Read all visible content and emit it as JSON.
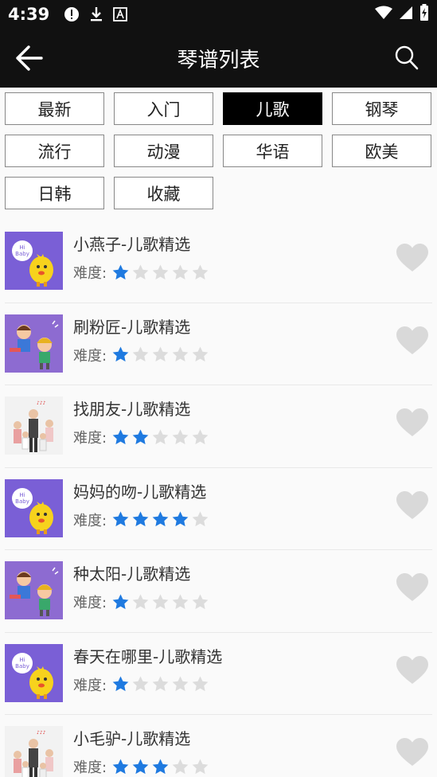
{
  "status": {
    "time": "4:39"
  },
  "header": {
    "title": "琴谱列表"
  },
  "filters": [
    {
      "label": "最新",
      "active": false
    },
    {
      "label": "入门",
      "active": false
    },
    {
      "label": "儿歌",
      "active": true
    },
    {
      "label": "钢琴",
      "active": false
    },
    {
      "label": "流行",
      "active": false
    },
    {
      "label": "动漫",
      "active": false
    },
    {
      "label": "华语",
      "active": false
    },
    {
      "label": "欧美",
      "active": false
    },
    {
      "label": "日韩",
      "active": false
    },
    {
      "label": "收藏",
      "active": false
    }
  ],
  "difficulty_label": "难度:",
  "songs": [
    {
      "title": "小燕子-儿歌精选",
      "rating": 1,
      "thumb": "hi-baby-chick"
    },
    {
      "title": "刷粉匠-儿歌精选",
      "rating": 1,
      "thumb": "kids-cartoon"
    },
    {
      "title": "找朋友-儿歌精选",
      "rating": 2,
      "thumb": "kids-photo"
    },
    {
      "title": "妈妈的吻-儿歌精选",
      "rating": 4,
      "thumb": "hi-baby-chick"
    },
    {
      "title": "种太阳-儿歌精选",
      "rating": 1,
      "thumb": "kids-cartoon"
    },
    {
      "title": "春天在哪里-儿歌精选",
      "rating": 1,
      "thumb": "hi-baby-chick"
    },
    {
      "title": "小毛驴-儿歌精选",
      "rating": 3,
      "thumb": "kids-photo"
    }
  ],
  "colors": {
    "accent_star": "#1f7ae0",
    "empty_star": "#dcdcdc",
    "heart": "#d9d9d9"
  }
}
